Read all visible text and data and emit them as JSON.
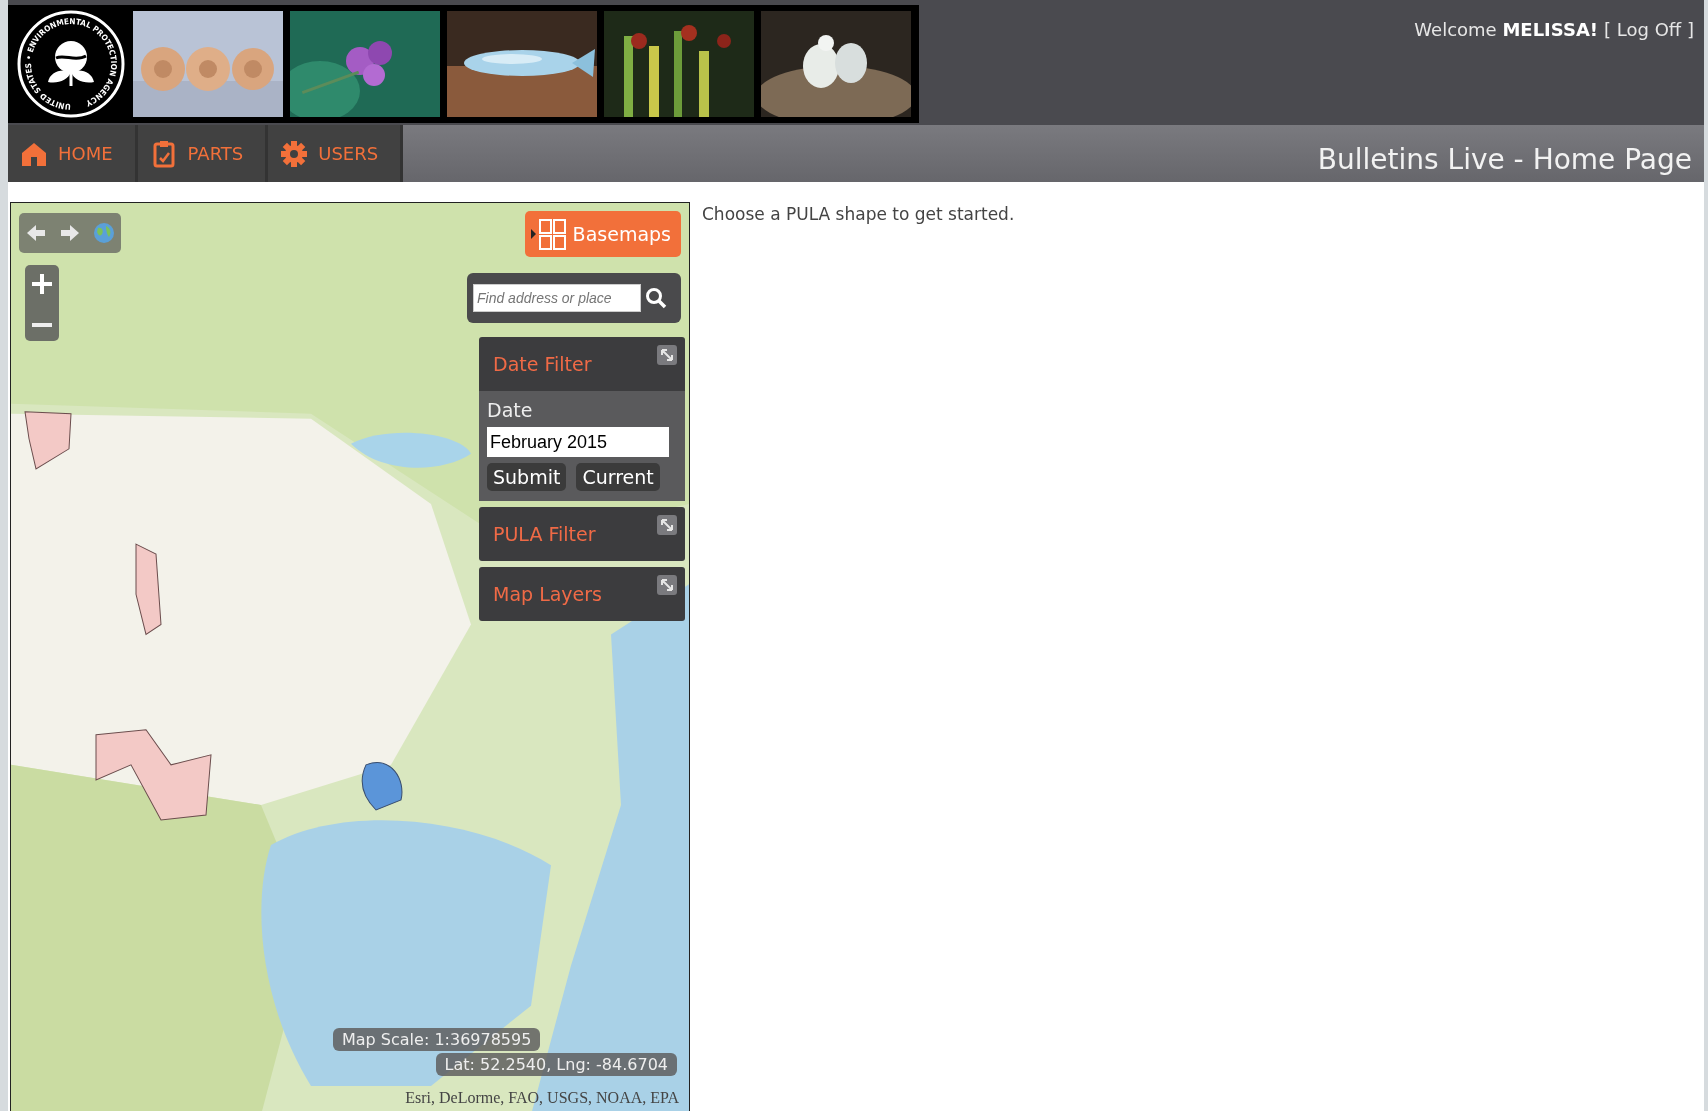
{
  "logo": {
    "seal_text": "UNITED STATES • ENVIRONMENTAL PROTECTION AGENCY"
  },
  "header": {
    "welcome": "Welcome **MELISSA!**",
    "logoff": "[ Log Off ]"
  },
  "nav": {
    "tabs": [
      {
        "label": "HOME",
        "kind": "home"
      },
      {
        "label": "PARTS",
        "kind": "parts"
      },
      {
        "label": "USERS",
        "kind": "users"
      }
    ],
    "page_title": "Bulletins Live - Home Page"
  },
  "map": {
    "basemaps_button": "Basemaps",
    "search": {
      "placeholder": "Find address or place"
    },
    "panels": [
      {
        "title": "Date Filter",
        "expanded": true,
        "field_label": "Date",
        "value": "February 2015",
        "buttons": [
          "Submit",
          "Current"
        ]
      },
      {
        "title": "PULA Filter",
        "expanded": false
      },
      {
        "title": "Map Layers",
        "expanded": false
      }
    ],
    "scale": "Map Scale: 1:36978595",
    "coordinates": "Lat: 52.2540, Lng: -84.6704",
    "attribution": "Esri, DeLorme, FAO, USGS, NOAA, EPA"
  },
  "message": "Choose a PULA shape to get started."
}
